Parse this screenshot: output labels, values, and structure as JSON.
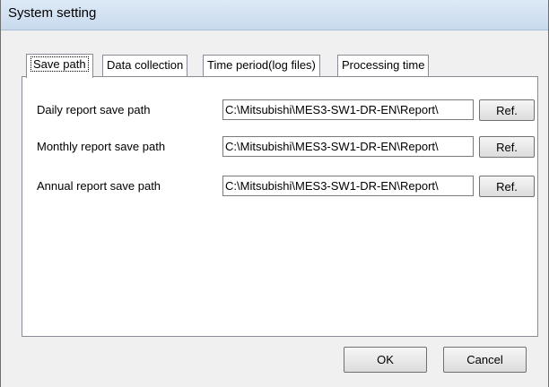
{
  "window": {
    "title": "System setting"
  },
  "tabs": [
    {
      "label": "Save path",
      "active": true
    },
    {
      "label": "Data collection",
      "active": false
    },
    {
      "label": "Time period(log files)",
      "active": false
    },
    {
      "label": "Processing time",
      "active": false
    }
  ],
  "save_path": {
    "rows": [
      {
        "label": "Daily report save path",
        "value": "C:\\Mitsubishi\\MES3-SW1-DR-EN\\Report\\",
        "button": "Ref."
      },
      {
        "label": "Monthly report save path",
        "value": "C:\\Mitsubishi\\MES3-SW1-DR-EN\\Report\\",
        "button": "Ref."
      },
      {
        "label": "Annual report save path",
        "value": "C:\\Mitsubishi\\MES3-SW1-DR-EN\\Report\\",
        "button": "Ref."
      }
    ]
  },
  "footer": {
    "ok_label": "OK",
    "cancel_label": "Cancel"
  }
}
